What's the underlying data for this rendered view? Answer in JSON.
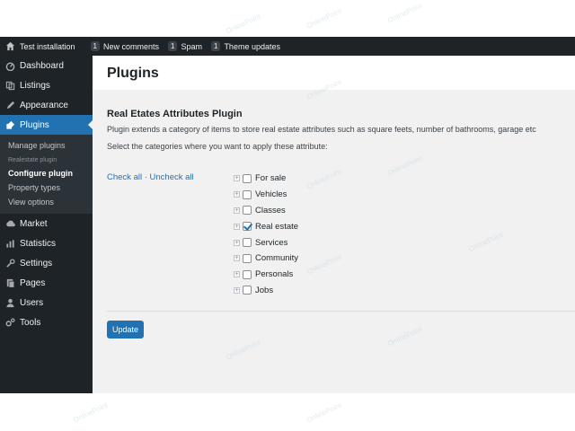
{
  "adminbar": {
    "site": "Test installation",
    "items": [
      {
        "count": "1",
        "label": "New comments"
      },
      {
        "count": "1",
        "label": "Spam"
      },
      {
        "count": "1",
        "label": "Theme updates"
      }
    ]
  },
  "sidebar": {
    "items": [
      {
        "label": "Dashboard",
        "icon": "dashboard-icon"
      },
      {
        "label": "Listings",
        "icon": "listings-icon"
      },
      {
        "label": "Appearance",
        "icon": "appearance-icon"
      },
      {
        "label": "Plugins",
        "icon": "plugins-icon"
      },
      {
        "label": "Market",
        "icon": "market-icon"
      },
      {
        "label": "Statistics",
        "icon": "statistics-icon"
      },
      {
        "label": "Settings",
        "icon": "settings-icon"
      },
      {
        "label": "Pages",
        "icon": "pages-icon"
      },
      {
        "label": "Users",
        "icon": "users-icon"
      },
      {
        "label": "Tools",
        "icon": "tools-icon"
      }
    ],
    "submenu": {
      "manage": "Manage plugins",
      "group": "Realestate plugin",
      "configure": "Configure plugin",
      "types": "Property types",
      "options": "View options"
    }
  },
  "page": {
    "title": "Plugins",
    "heading": "Real Etates Attributes Plugin",
    "description": "Plugin extends a category of items to store real estate attributes such as square feets, number of bathrooms, garage etc",
    "instruction": "Select the categories where you want to apply these attribute:",
    "check_all": "Check all",
    "separator": "·",
    "uncheck_all": "Uncheck all",
    "update_label": "Update"
  },
  "categories": [
    {
      "label": "For sale",
      "checked": false
    },
    {
      "label": "Vehicles",
      "checked": false
    },
    {
      "label": "Classes",
      "checked": false
    },
    {
      "label": "Real estate",
      "checked": true
    },
    {
      "label": "Services",
      "checked": false
    },
    {
      "label": "Community",
      "checked": false
    },
    {
      "label": "Personals",
      "checked": false
    },
    {
      "label": "Jobs",
      "checked": false
    }
  ],
  "watermark": "OnlinePoint",
  "colors": {
    "accent": "#2271b1",
    "sidebar": "#1d2327",
    "background": "#f1f1f1"
  }
}
